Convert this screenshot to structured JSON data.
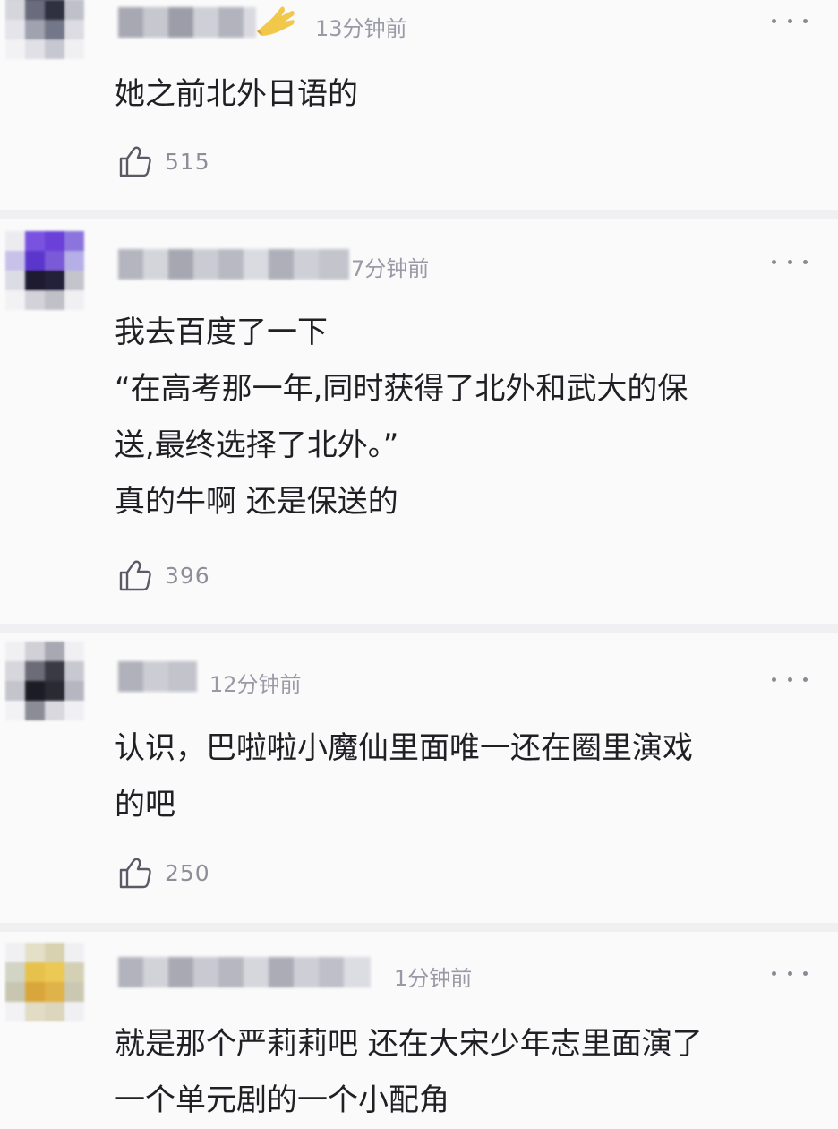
{
  "comments": [
    {
      "time": "13分钟前",
      "lines": [
        "她之前北外日语的"
      ],
      "likes": "515"
    },
    {
      "time": "7分钟前",
      "lines": [
        "我去百度了一下",
        "“在高考那一年,同时获得了北外和武大的保",
        "送,最终选择了北外。”",
        "真的牛啊 还是保送的"
      ],
      "likes": "396"
    },
    {
      "time": "12分钟前",
      "lines": [
        "认识，巴啦啦小魔仙里面唯一还在圈里演戏",
        "的吧"
      ],
      "likes": "250"
    },
    {
      "time": "1分钟前",
      "lines": [
        "就是那个严莉莉吧 还在大宋少年志里面演了",
        "一个单元剧的一个小配角"
      ]
    }
  ],
  "icons": {
    "like": "thumbs-up-outline-icon",
    "more": "more-dots-icon",
    "badge": "gold-hand-badge-icon"
  },
  "colors": {
    "background": "#fafafb",
    "text": "#1f1f24",
    "meta": "#9a9aa6",
    "separator": "#f0f0f3"
  }
}
